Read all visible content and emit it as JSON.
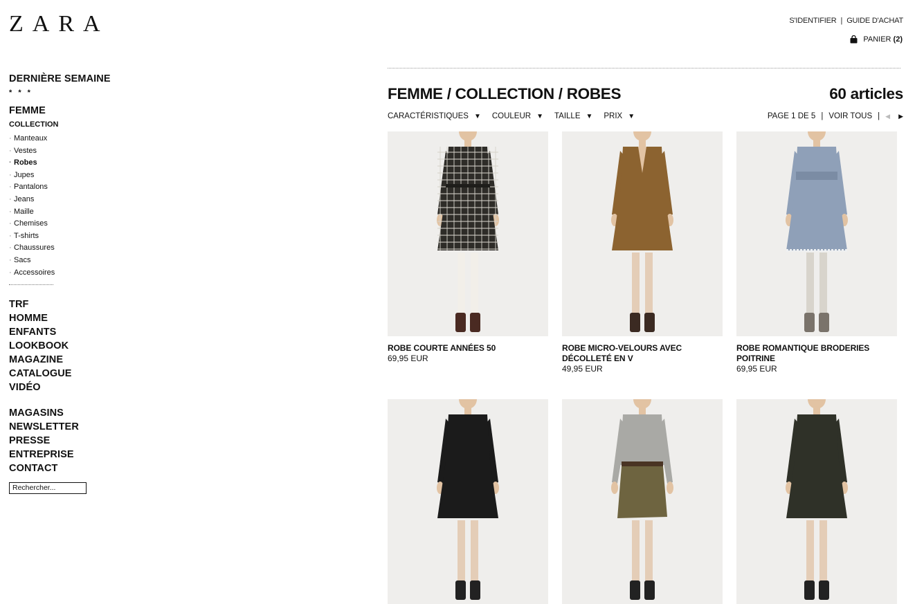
{
  "brand": {
    "logo": "ZARA"
  },
  "header": {
    "login": "S'IDENTIFIER",
    "separator": "|",
    "guide": "GUIDE D'ACHAT",
    "cart_label": "PANIER",
    "cart_count": "(2)",
    "cart_icon": "shopping-bag-icon"
  },
  "nav": {
    "last_week": "DERNIÈRE SEMAINE",
    "stars": "* * *",
    "femme": "FEMME",
    "collection": "COLLECTION",
    "items": [
      {
        "label": "Manteaux",
        "active": false
      },
      {
        "label": "Vestes",
        "active": false
      },
      {
        "label": "Robes",
        "active": true
      },
      {
        "label": "Jupes",
        "active": false
      },
      {
        "label": "Pantalons",
        "active": false
      },
      {
        "label": "Jeans",
        "active": false
      },
      {
        "label": "Maille",
        "active": false
      },
      {
        "label": "Chemises",
        "active": false
      },
      {
        "label": "T-shirts",
        "active": false
      },
      {
        "label": "Chaussures",
        "active": false
      },
      {
        "label": "Sacs",
        "active": false
      },
      {
        "label": "Accessoires",
        "active": false
      }
    ],
    "sections": [
      "TRF",
      "HOMME",
      "ENFANTS",
      "LOOKBOOK",
      "MAGAZINE",
      "CATALOGUE",
      "VIDÉO"
    ],
    "info": [
      "MAGASINS",
      "NEWSLETTER",
      "PRESSE",
      "ENTREPRISE",
      "CONTACT"
    ],
    "search_placeholder": "Rechercher..."
  },
  "main": {
    "breadcrumb": "FEMME / COLLECTION / ROBES",
    "count": "60 articles",
    "filters": [
      "CARACTÉRISTIQUES",
      "COULEUR",
      "TAILLE",
      "PRIX"
    ],
    "filter_arrow": "▼",
    "pager": {
      "page": "PAGE 1 DE 5",
      "separator": "|",
      "view_all": "VOIR TOUS",
      "prev": "◀",
      "next": "▶"
    }
  },
  "products": [
    {
      "name": "ROBE COURTE ANNÉES 50",
      "price": "69,95 EUR",
      "dress": "plaid",
      "color": "#2e2c28",
      "legs": "#f2efe9",
      "shoe": "#4a2a22"
    },
    {
      "name": "ROBE MICRO-VELOURS AVEC DÉCOLLETÉ EN V",
      "price": "49,95 EUR",
      "dress": "tunic",
      "color": "#8c6330",
      "legs": "#e4cdb7",
      "shoe": "#3b2a22"
    },
    {
      "name": "ROBE ROMANTIQUE BRODERIES POITRINE",
      "price": "69,95 EUR",
      "dress": "smock",
      "color": "#8fa0b8",
      "legs": "#d8d4cc",
      "shoe": "#7a736b"
    },
    {
      "name": "",
      "price": "",
      "dress": "drape",
      "color": "#1b1b1b",
      "legs": "#e4cdb7",
      "shoe": "#222"
    },
    {
      "name": "",
      "price": "",
      "dress": "skirt",
      "color": "#6e6440",
      "top": "#a9a9a5",
      "legs": "#e4cdb7",
      "shoe": "#222"
    },
    {
      "name": "",
      "price": "",
      "dress": "wrap",
      "color": "#2f3128",
      "legs": "#e4cdb7",
      "shoe": "#222"
    }
  ]
}
